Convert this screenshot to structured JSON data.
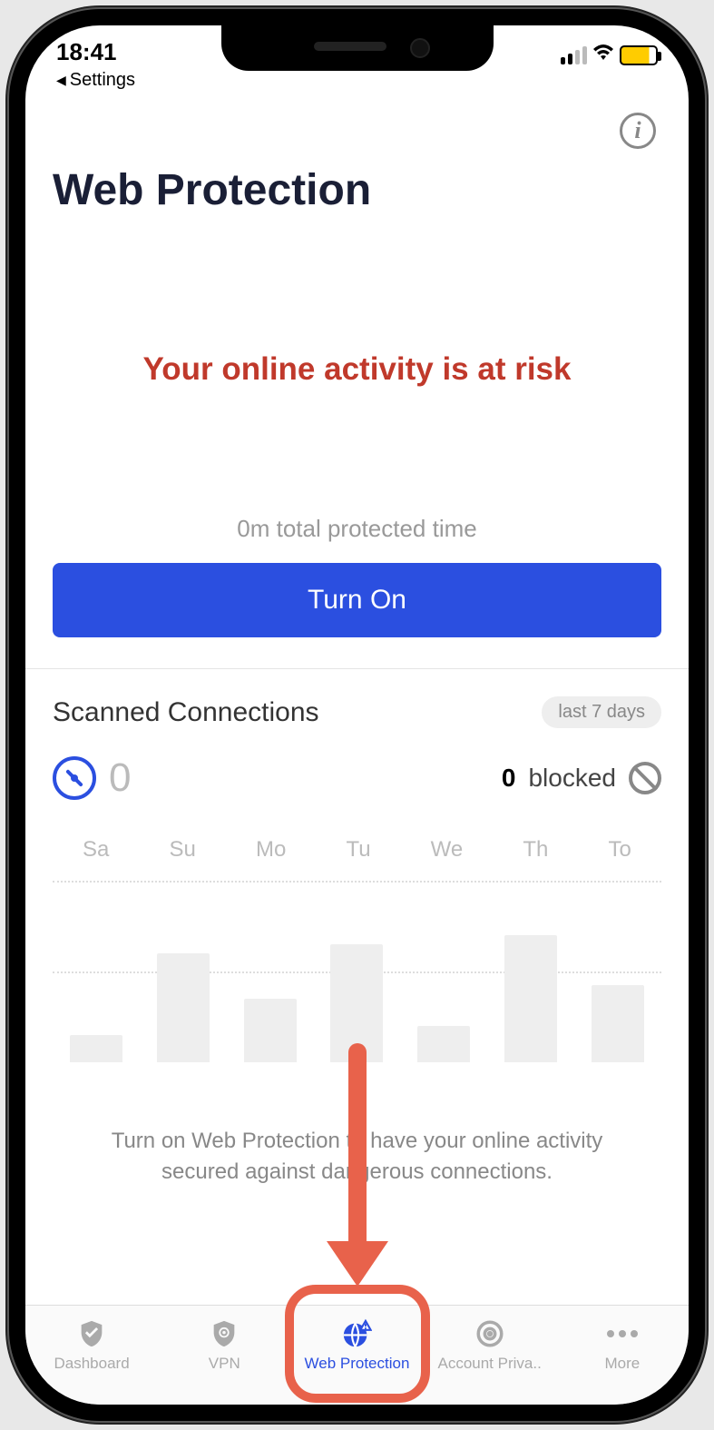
{
  "status": {
    "time": "18:41",
    "back_label": "Settings"
  },
  "header": {
    "title": "Web Protection",
    "info_icon": "i"
  },
  "risk_message": "Your online activity is at risk",
  "protected_time": "0m total protected time",
  "turn_on_label": "Turn On",
  "scanned": {
    "title": "Scanned Connections",
    "period": "last 7 days",
    "count": "0",
    "blocked_count": "0",
    "blocked_label": "blocked"
  },
  "chart_data": {
    "type": "bar",
    "categories": [
      "Sa",
      "Su",
      "Mo",
      "Tu",
      "We",
      "Th",
      "To"
    ],
    "values": [
      30,
      120,
      70,
      130,
      40,
      140,
      85
    ],
    "title": "",
    "xlabel": "",
    "ylabel": "",
    "ylim": [
      0,
      200
    ]
  },
  "helper_text_1": "Turn on Web Protection to have your online activity",
  "helper_text_2": "secured against dangerous connections.",
  "tabbar": {
    "items": [
      {
        "label": "Dashboard"
      },
      {
        "label": "VPN"
      },
      {
        "label": "Web Protection"
      },
      {
        "label": "Account Priva.."
      },
      {
        "label": "More"
      }
    ]
  }
}
